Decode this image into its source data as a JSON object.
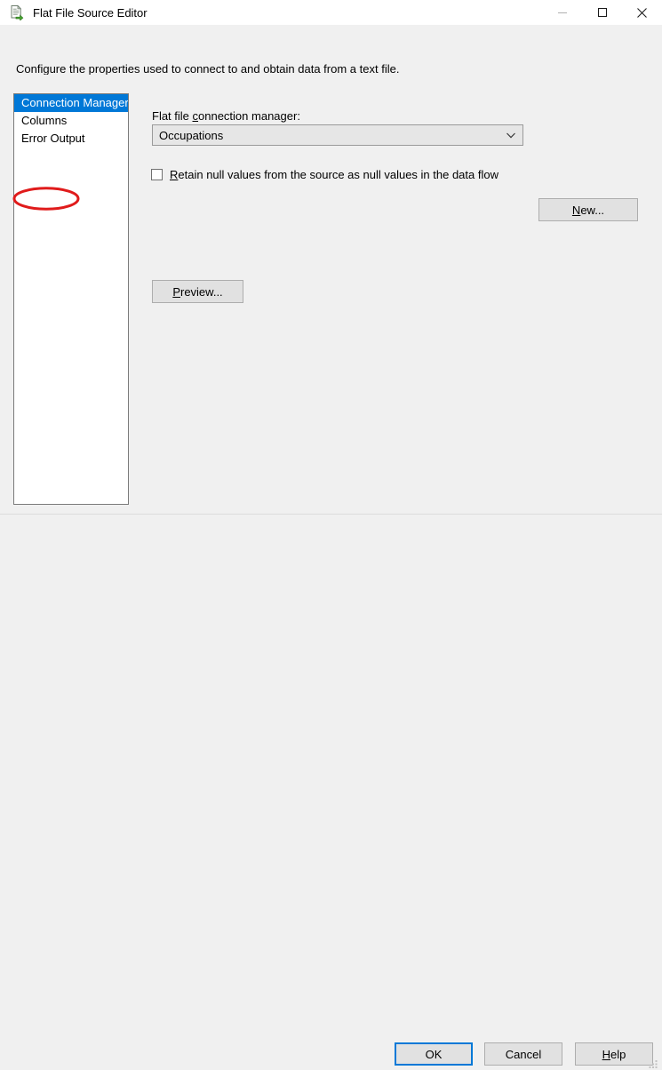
{
  "window": {
    "title": "Flat File Source Editor",
    "icon": "flat-file-source-icon",
    "controls": {
      "minimize": "minimize-icon",
      "maximize": "maximize-icon",
      "close": "close-icon"
    }
  },
  "header": {
    "description": "Configure the properties used to connect to and obtain data from a text file."
  },
  "sidebar": {
    "items": [
      {
        "label": "Connection Manager",
        "selected": true
      },
      {
        "label": "Columns",
        "selected": false
      },
      {
        "label": "Error Output",
        "selected": false
      }
    ]
  },
  "annotation": {
    "shape": "ellipse",
    "target": "Columns",
    "color": "#e01b1b"
  },
  "main": {
    "connection_label_pre": "Flat file ",
    "connection_label_accel": "c",
    "connection_label_post": "onnection manager:",
    "connection_value": "Occupations",
    "dropdown_icon": "chevron-down-icon",
    "new_button_accel": "N",
    "new_button_rest": "ew...",
    "retain_null_accel": "R",
    "retain_null_rest": "etain null values from the source as null values in the data flow",
    "retain_null_checked": false,
    "preview_button_accel": "P",
    "preview_button_rest": "review..."
  },
  "footer": {
    "ok_label": "OK",
    "cancel_label": "Cancel",
    "help_accel": "H",
    "help_rest": "elp",
    "grip_icon": "resize-grip-icon"
  },
  "colors": {
    "accent": "#0078d7",
    "annotation": "#e01b1b",
    "background": "#f0f0f0"
  }
}
